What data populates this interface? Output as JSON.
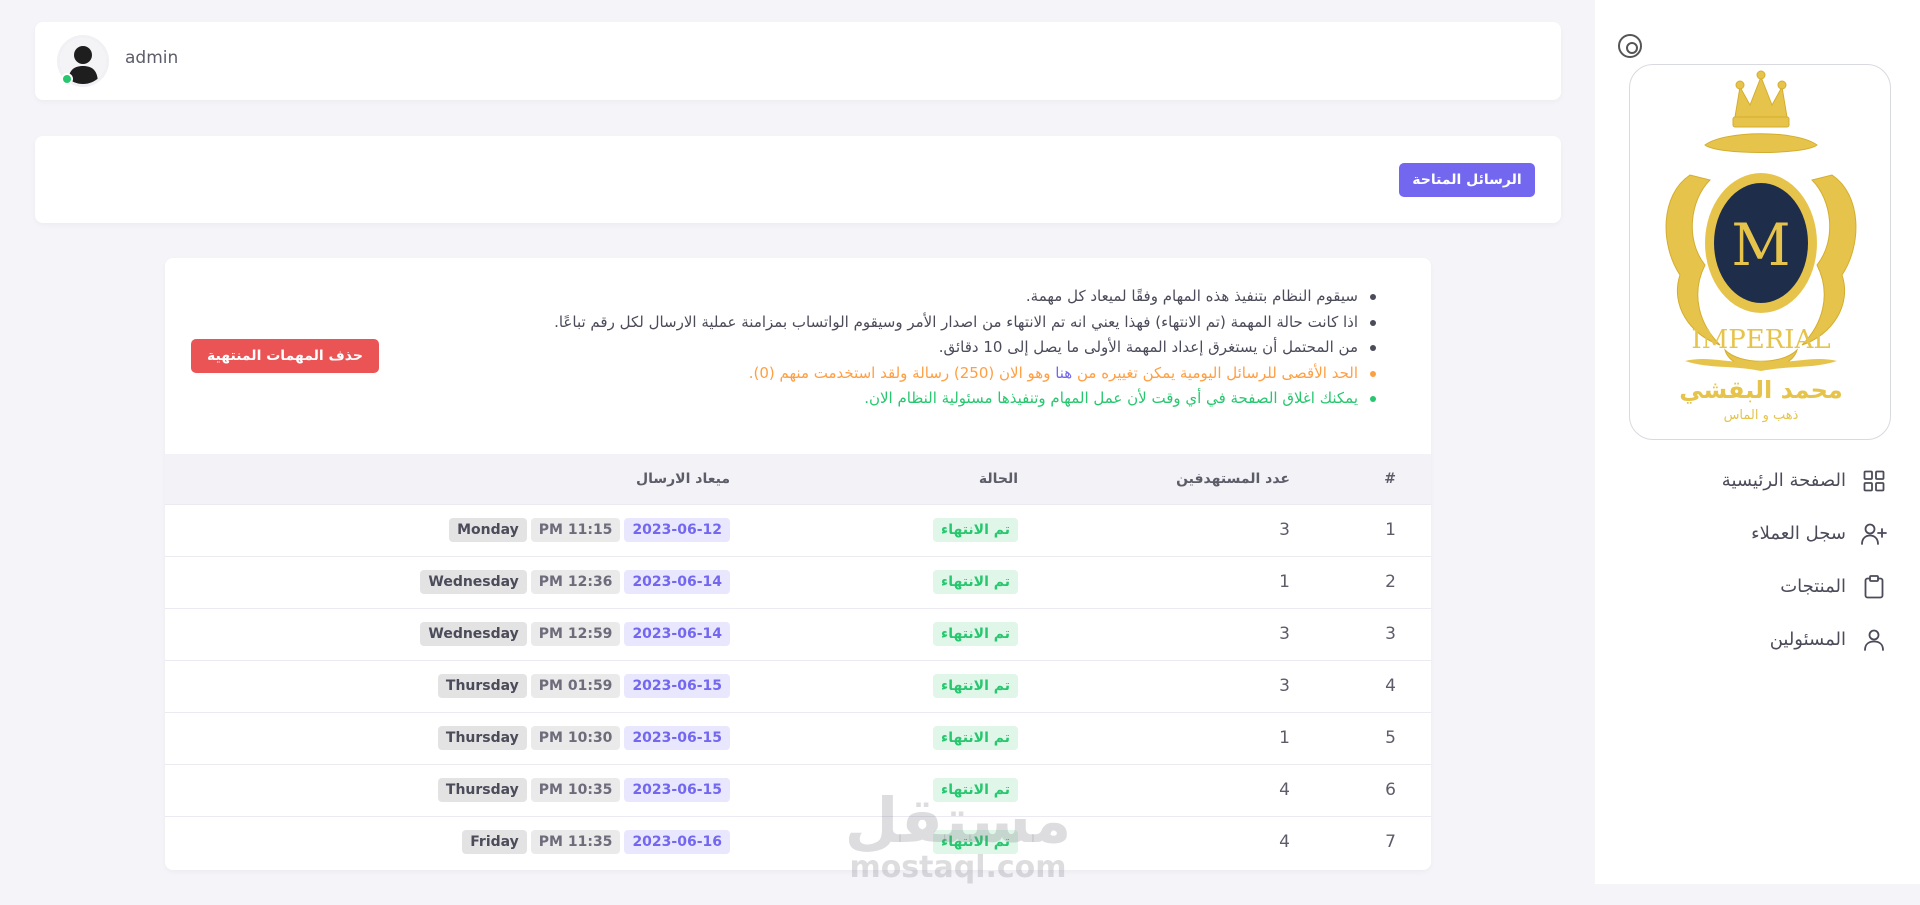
{
  "header": {
    "username": "admin"
  },
  "actions": {
    "available_messages_label": "الرسائل المتاحة",
    "delete_finished_label": "حذف المهمات المنتهية"
  },
  "notes": {
    "n1": "سيقوم النظام بتنفيذ هذه المهام وفقًا لميعاد كل مهمة.",
    "n2": "اذا كانت حالة المهمة (تم الانتهاء) فهذا يعني انه تم الانتهاء من اصدار الأمر وسيقوم الواتساب بمزامنة عملية الارسال لكل رقم تباعًا.",
    "n3": "من المحتمل أن يستغرق إعداد المهمة الأولى ما يصل إلى 10 دقائق.",
    "n4_before": "الحد الأقصى للرسائل اليومية يمكن تغييره من ",
    "n4_link": "هنا",
    "n4_after": " وهو الان (250) رسالة ولقد استخدمت منهم (0).",
    "n5": "يمكنك اغلاق الصفحة في أي وقت لأن عمل المهام وتنفيذها مسئولية النظام الان."
  },
  "table": {
    "headers": [
      "#",
      "عدد المستهدفين",
      "الحالة",
      "ميعاد الارسال"
    ],
    "rows": [
      {
        "num": "1",
        "targets": "3",
        "status": "تم الانتهاء",
        "date": "2023-06-12",
        "time": "PM 11:15",
        "day": "Monday"
      },
      {
        "num": "2",
        "targets": "1",
        "status": "تم الانتهاء",
        "date": "2023-06-14",
        "time": "PM 12:36",
        "day": "Wednesday"
      },
      {
        "num": "3",
        "targets": "3",
        "status": "تم الانتهاء",
        "date": "2023-06-14",
        "time": "PM 12:59",
        "day": "Wednesday"
      },
      {
        "num": "4",
        "targets": "3",
        "status": "تم الانتهاء",
        "date": "2023-06-15",
        "time": "PM 01:59",
        "day": "Thursday"
      },
      {
        "num": "5",
        "targets": "1",
        "status": "تم الانتهاء",
        "date": "2023-06-15",
        "time": "PM 10:30",
        "day": "Thursday"
      },
      {
        "num": "6",
        "targets": "4",
        "status": "تم الانتهاء",
        "date": "2023-06-15",
        "time": "PM 10:35",
        "day": "Thursday"
      },
      {
        "num": "7",
        "targets": "4",
        "status": "تم الانتهاء",
        "date": "2023-06-16",
        "time": "PM 11:35",
        "day": "Friday"
      }
    ]
  },
  "sidebar": {
    "logo": {
      "monogram": "M",
      "brand": "IMPERIAL",
      "name_ar": "محمد البقشي",
      "tagline_ar": "ذهب و الماس"
    },
    "items": [
      {
        "label": "الصفحة الرئيسية",
        "icon": "grid-icon"
      },
      {
        "label": "سجل العملاء",
        "icon": "user-plus-icon"
      },
      {
        "label": "المنتجات",
        "icon": "clipboard-icon"
      },
      {
        "label": "المسئولين",
        "icon": "user-icon"
      }
    ]
  },
  "watermark": {
    "ar": "مستقل",
    "en": "mostaql.com"
  },
  "colors": {
    "primary": "#7367f0",
    "danger": "#ea5455",
    "success": "#28c76f",
    "warning": "#ff9f43",
    "gold": "#e6c44c",
    "navy": "#1e2d4a"
  }
}
